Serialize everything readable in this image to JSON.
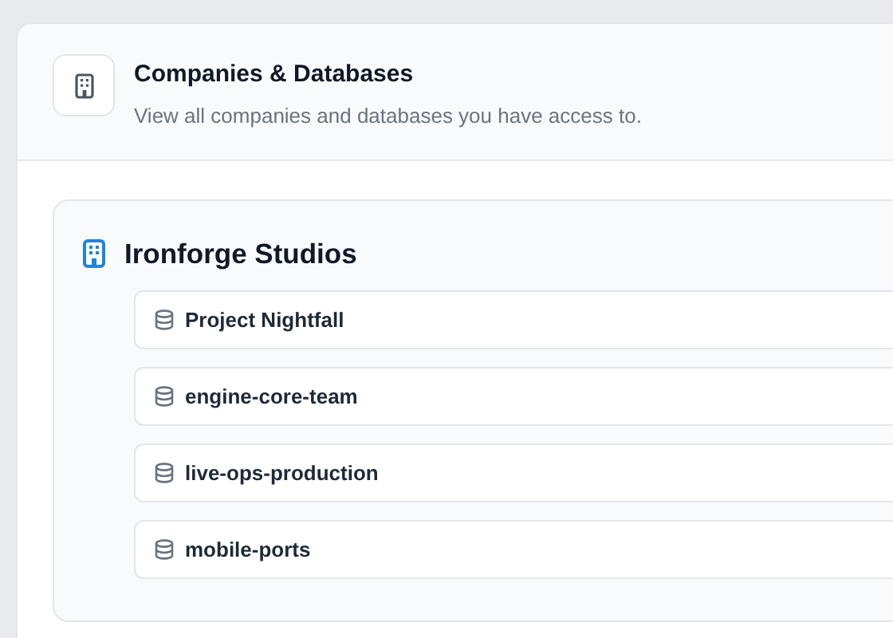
{
  "header": {
    "title": "Companies & Databases",
    "subtitle": "View all companies and databases you have access to."
  },
  "companies": [
    {
      "name": "Ironforge Studios",
      "databases": [
        {
          "name": "Project Nightfall"
        },
        {
          "name": "engine-core-team"
        },
        {
          "name": "live-ops-production"
        },
        {
          "name": "mobile-ports"
        }
      ]
    }
  ]
}
